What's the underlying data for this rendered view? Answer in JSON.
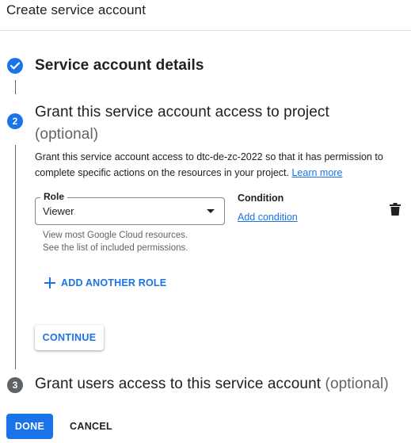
{
  "header": {
    "title": "Create service account"
  },
  "steps": [
    {
      "status": "done",
      "title": "Service account details"
    },
    {
      "number": "2",
      "status": "active",
      "title": "Grant this service account access to project",
      "optional_suffix": "(optional)"
    },
    {
      "number": "3",
      "status": "inactive",
      "title": "Grant users access to this service account",
      "optional_suffix": "(optional)"
    }
  ],
  "grant": {
    "description": "Grant this service account access to dtc-de-zc-2022 so that it has permission to complete specific actions on the resources in your project.",
    "learn_more": "Learn more",
    "role_label": "Role",
    "role_value": "Viewer",
    "role_hint_line1": "View most Google Cloud resources.",
    "role_hint_line2": "See the list of included permissions.",
    "condition_heading": "Condition",
    "add_condition": "Add condition",
    "add_role": "ADD ANOTHER ROLE",
    "continue": "CONTINUE"
  },
  "footer": {
    "done": "DONE",
    "cancel": "CANCEL"
  },
  "colors": {
    "accent": "#1a73e8",
    "inactive_step": "#5f6368",
    "text": "#202124"
  },
  "icons": [
    "check-icon",
    "delete-icon",
    "plus-icon",
    "dropdown-arrow-icon"
  ]
}
